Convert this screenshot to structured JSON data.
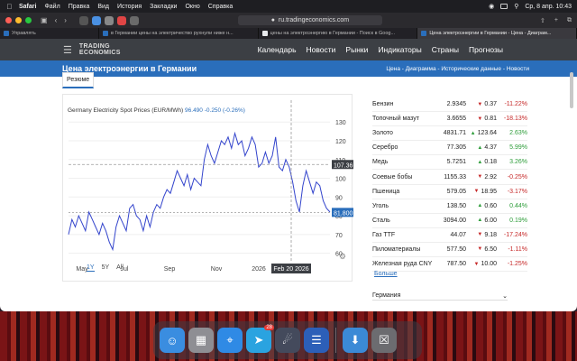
{
  "menubar": {
    "app": "Safari",
    "items": [
      "Файл",
      "Правка",
      "Вид",
      "История",
      "Закладки",
      "Окно",
      "Справка"
    ],
    "clock": "Ср, 8 апр.  10:43"
  },
  "browser": {
    "url": "ru.tradingeconomics.com",
    "tabs": [
      {
        "label": "Управлять"
      },
      {
        "label": "в Германии цены на электричество рухнули ниже н..."
      },
      {
        "label": "цены на электроэнергию в Германии - Поиск в Goog..."
      },
      {
        "label": "Цена электроэнергии в Германии - Цена - Диаграм..."
      }
    ]
  },
  "site": {
    "logo_line1": "TRADING",
    "logo_line2": "ECONOMICS",
    "nav": [
      "Календарь",
      "Новости",
      "Рынки",
      "Индикаторы",
      "Страны",
      "Прогнозы"
    ],
    "page_title": "Цена электроэнергии в Германии",
    "breadcrumbs": "Цена - Диаграмма - Исторические данные - Новости",
    "summary_tab": "Резюме",
    "more_link": "Больше",
    "country_label": "Германия"
  },
  "chart": {
    "title": "Germany Electricity Spot Prices (EUR/MWh)",
    "last_value": "96.490",
    "change": "-0.250 (-0.26%)",
    "marker_label": "107.36",
    "last_label": "81.800",
    "date_marker": "Feb 20 2026",
    "ranges": [
      "1Y",
      "5Y",
      "All"
    ],
    "active_range": "1Y"
  },
  "chart_data": {
    "type": "line",
    "title": "Germany Electricity Spot Prices (EUR/MWh)",
    "xlabel": "",
    "ylabel": "",
    "x_ticks": [
      "May",
      "Jul",
      "Sep",
      "Nov",
      "2026"
    ],
    "y_ticks": [
      60,
      70,
      80,
      90,
      100,
      110,
      120,
      130
    ],
    "ylim": [
      55,
      133
    ],
    "grid": true,
    "series": [
      {
        "values": [
          70,
          78,
          74,
          80,
          76,
          72,
          82,
          78,
          74,
          70,
          76,
          72,
          66,
          62,
          74,
          80,
          76,
          72,
          84,
          86,
          80,
          78,
          72,
          80,
          74,
          82,
          86,
          84,
          90,
          94,
          92,
          98,
          104,
          100,
          96,
          102,
          94,
          100,
          98,
          96,
          110,
          118,
          112,
          108,
          114,
          120,
          118,
          122,
          116,
          124,
          118,
          120,
          112,
          116,
          122,
          118,
          106,
          108,
          114,
          108,
          112,
          122,
          106,
          104,
          110,
          106,
          98,
          88,
          82,
          96,
          104,
          98,
          92,
          98,
          96,
          88,
          84,
          82
        ]
      }
    ]
  },
  "commodities": [
    {
      "name": "Бензин",
      "price": "2.9345",
      "change": "0.37",
      "dir": "down",
      "pct": "-11.22%"
    },
    {
      "name": "Топочный мазут",
      "price": "3.6655",
      "change": "0.81",
      "dir": "down",
      "pct": "-18.13%"
    },
    {
      "name": "Золото",
      "price": "4831.71",
      "change": "123.64",
      "dir": "up",
      "pct": "2.63%"
    },
    {
      "name": "Серебро",
      "price": "77.305",
      "change": "4.37",
      "dir": "up",
      "pct": "5.99%"
    },
    {
      "name": "Медь",
      "price": "5.7251",
      "change": "0.18",
      "dir": "up",
      "pct": "3.26%"
    },
    {
      "name": "Соевые бобы",
      "price": "1155.33",
      "change": "2.92",
      "dir": "down",
      "pct": "-0.25%"
    },
    {
      "name": "Пшеница",
      "price": "579.05",
      "change": "18.95",
      "dir": "down",
      "pct": "-3.17%"
    },
    {
      "name": "Уголь",
      "price": "138.50",
      "change": "0.60",
      "dir": "up",
      "pct": "0.44%"
    },
    {
      "name": "Сталь",
      "price": "3094.00",
      "change": "6.00",
      "dir": "up",
      "pct": "0.19%"
    },
    {
      "name": "Газ TTF",
      "price": "44.07",
      "change": "9.18",
      "dir": "down",
      "pct": "-17.24%"
    },
    {
      "name": "Пиломатериалы",
      "price": "577.50",
      "change": "6.50",
      "dir": "down",
      "pct": "-1.11%"
    },
    {
      "name": "Железная руда CNY",
      "price": "787.50",
      "change": "10.00",
      "dir": "down",
      "pct": "-1.25%"
    }
  ],
  "dock": {
    "apps": [
      {
        "name": "finder",
        "color": "#3a8de0"
      },
      {
        "name": "launchpad",
        "color": "#8e8e93"
      },
      {
        "name": "safari",
        "color": "#2f8ae5"
      },
      {
        "name": "telegram",
        "color": "#2aa3e0",
        "badge": "28"
      },
      {
        "name": "rocket",
        "color": "#444a5c"
      },
      {
        "name": "notes",
        "color": "#2c5fb8"
      },
      {
        "name": "downloads",
        "color": "#3b8ad6"
      },
      {
        "name": "trash",
        "color": "#6c6c70"
      }
    ]
  }
}
